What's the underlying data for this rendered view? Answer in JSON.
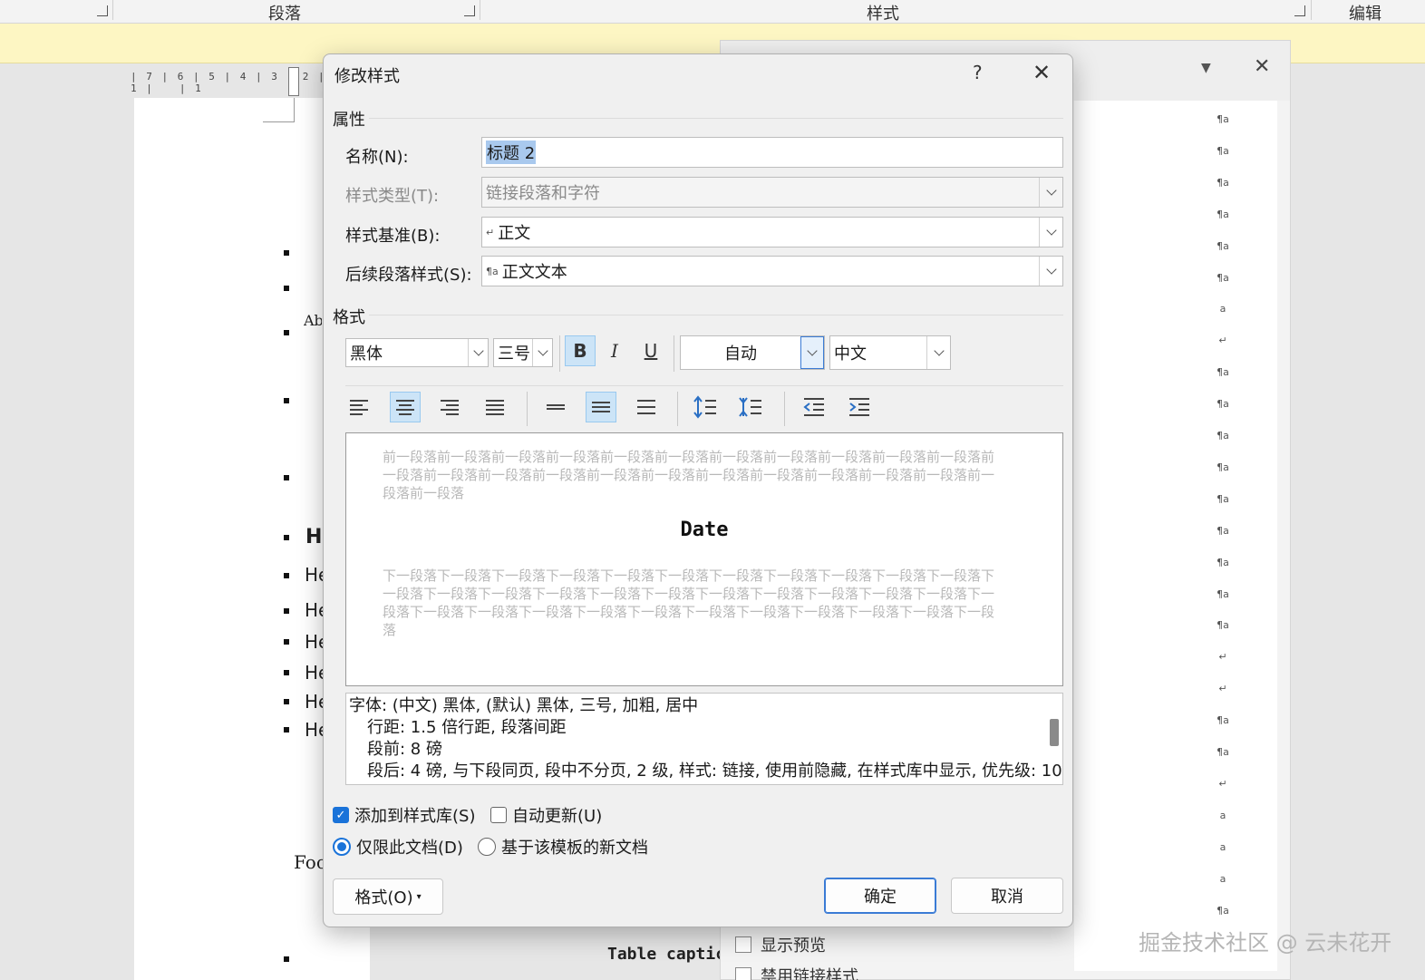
{
  "ribbon": {
    "groups": [
      "段落",
      "样式",
      "编辑"
    ]
  },
  "ruler": {
    "text": "| 7 | 6 | 5 | 4 | 3 | 2 | 1 |",
    "after": "| 1"
  },
  "document": {
    "snippets": {
      "ab": "Ab",
      "h_large": "H",
      "he": "He",
      "foo": "Foo",
      "table_caption": "Table captic"
    }
  },
  "styles_pane": {
    "icons": [
      "¶a",
      "¶a",
      "¶a",
      "¶a",
      "¶a",
      "¶a",
      "a",
      "↵",
      "¶a",
      "¶a",
      "¶a",
      "¶a",
      "¶a",
      "¶a",
      "¶a",
      "¶a",
      "¶a",
      "↵",
      "↵",
      "¶a",
      "¶a",
      "↵",
      "a",
      "a",
      "a",
      "¶a"
    ],
    "show_preview": "显示预览",
    "disable_linked": "禁用链接样式"
  },
  "dialog": {
    "title": "修改样式",
    "help": "?",
    "section_properties": "属性",
    "name_label": "名称(N):",
    "name_value": "标题 2",
    "type_label": "样式类型(T):",
    "type_value": "链接段落和字符",
    "based_label": "样式基准(B):",
    "based_value": "正文",
    "based_glyph": "↵",
    "next_label": "后续段落样式(S):",
    "next_value": "正文文本",
    "next_glyph": "¶a",
    "section_format": "格式",
    "font": "黑体",
    "size": "三号",
    "bold": "B",
    "italic": "I",
    "underline": "U",
    "color": "自动",
    "script": "中文",
    "preview": {
      "before": "前一段落前一段落前一段落前一段落前一段落前一段落前一段落前一段落前一段落前一段落前一段落前一段落前一段落前一段落前一段落前一段落前一段落前一段落前一段落前一段落前一段落前一段落前一段落前一段落",
      "sample": "Date",
      "after": "下一段落下一段落下一段落下一段落下一段落下一段落下一段落下一段落下一段落下一段落下一段落下一段落下一段落下一段落下一段落下一段落下一段落下一段落下一段落下一段落下一段落下一段落下一段落下一段落下一段落下一段落下一段落下一段落下一段落下一段落下一段落下一段落下一段落下一段落"
    },
    "description": {
      "line1": "字体: (中文) 黑体, (默认) 黑体, 三号, 加粗, 居中",
      "line2": "行距: 1.5 倍行距, 段落间距",
      "line3": "段前: 8 磅",
      "line4": "段后: 4 磅, 与下段同页, 段中不分页, 2 级, 样式: 链接, 使用前隐藏, 在样式库中显示, 优先级: 10"
    },
    "add_to_gallery": "添加到样式库(S)",
    "add_to_gallery_checked": true,
    "auto_update": "自动更新(U)",
    "auto_update_checked": false,
    "only_this_doc": "仅限此文档(D)",
    "new_docs": "基于该模板的新文档",
    "format_button": "格式(O)",
    "ok": "确定",
    "cancel": "取消"
  },
  "watermark": "掘金技术社区 @ 云未花开"
}
